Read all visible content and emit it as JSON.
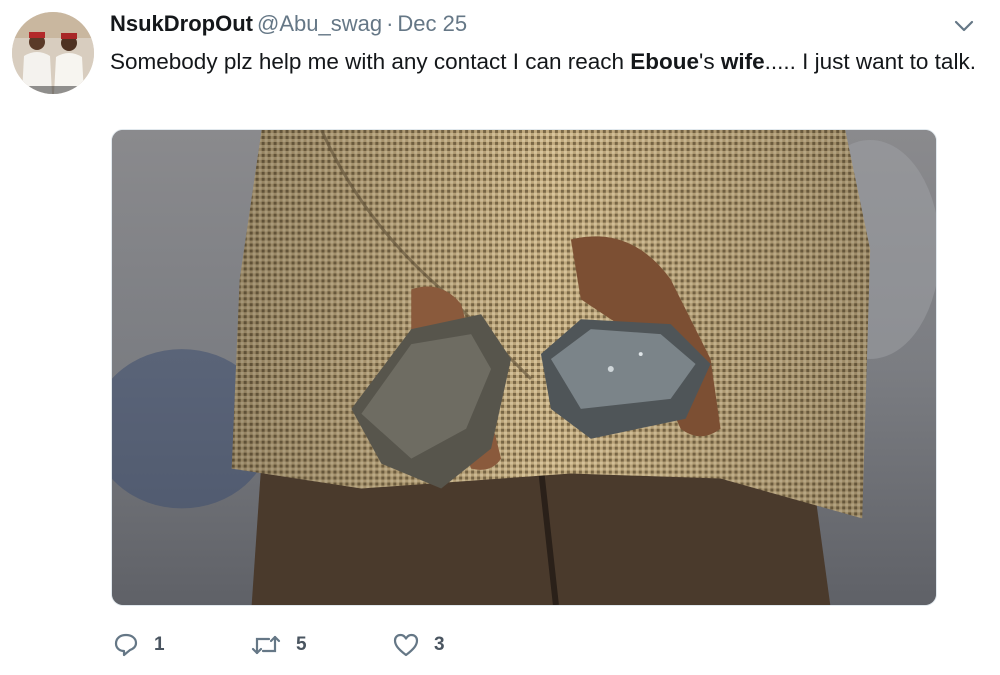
{
  "tweet": {
    "display_name": "NsukDropOut",
    "handle": "@Abu_swag",
    "separator": "·",
    "date": "Dec 25",
    "text": {
      "part1": "Somebody plz help me with any contact I can reach ",
      "bold1": "Eboue",
      "part2": "'s ",
      "bold2": "wife",
      "part3": "..... I just want to talk."
    }
  },
  "actions": {
    "reply_count": "1",
    "retweet_count": "5",
    "like_count": "3"
  },
  "icons": {
    "menu": "chevron-down-icon",
    "reply": "reply-icon",
    "retweet": "retweet-icon",
    "like": "heart-icon"
  },
  "colors": {
    "text": "#14171a",
    "muted": "#657786",
    "border": "#e1e8ed"
  }
}
